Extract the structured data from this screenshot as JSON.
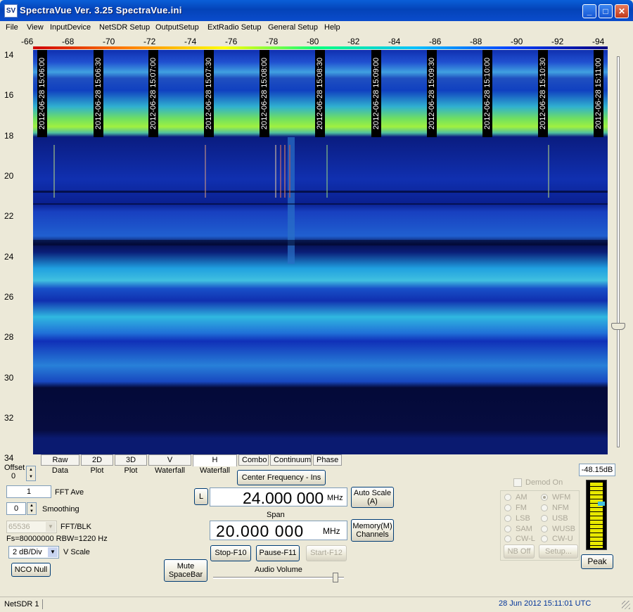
{
  "window": {
    "title": "SpectraVue Ver. 3.25  SpectraVue.ini",
    "icon_text": "SV",
    "minimize_label": "_",
    "maximize_label": "□",
    "close_label": "✕"
  },
  "menu": [
    "File",
    "View",
    "InputDevice",
    "NetSDR Setup",
    "OutputSetup",
    "ExtRadio Setup",
    "General Setup",
    "Help"
  ],
  "scale_labels": [
    "-66",
    "-68",
    "-70",
    "-72",
    "-74",
    "-76",
    "-78",
    "-80",
    "-82",
    "-84",
    "-86",
    "-88",
    "-90",
    "-92",
    "-94"
  ],
  "y_labels": [
    "14",
    "16",
    "18",
    "20",
    "22",
    "24",
    "26",
    "28",
    "30",
    "32",
    "34"
  ],
  "timestamps": [
    "2012-06-28 15:06:00",
    "2012-06-28 15:06:30",
    "2012-06-28 15:07:00",
    "2012-06-28 15:07:30",
    "2012-06-28 15:08:00",
    "2012-06-28 15:08:30",
    "2012-06-28 15:09:00",
    "2012-06-28 15:09:30",
    "2012-06-28 15:10:00",
    "2012-06-28 15:10:30",
    "2012-06-28 15:11:00"
  ],
  "tabs": [
    "Raw Data",
    "2D Plot",
    "3D Plot",
    "V Waterfall",
    "H Waterfall",
    "Combo",
    "Continuum",
    "Phase"
  ],
  "active_tab": "H Waterfall",
  "left_panel": {
    "offset_label": "Offset",
    "offset_value": "0",
    "fft_ave_value": "1",
    "fft_ave_label": "FFT Ave",
    "smoothing_value": "0",
    "smoothing_label": "Smoothing",
    "fft_blk_value": "65536",
    "fft_blk_label": "FFT/BLK",
    "fs_text": "Fs=80000000 RBW=1220 Hz",
    "vscale_value": "2 dB/Div",
    "vscale_label": "V Scale",
    "nco_null": "NCO Null"
  },
  "center": {
    "center_freq_button": "Center Frequency - Ins",
    "l_button": "L",
    "center_freq_value": "24.000 000",
    "center_freq_unit": "MHz",
    "auto_scale": "Auto Scale",
    "auto_scale_key": "(A)",
    "span_label": "Span",
    "span_value": "20.000 000",
    "span_unit": "MHz",
    "memory": "Memory(M)",
    "channels": "Channels",
    "stop": "Stop-F10",
    "pause": "Pause-F11",
    "start": "Start-F12",
    "mute": "Mute",
    "spacebar": "SpaceBar",
    "audio_volume": "Audio Volume"
  },
  "demod": {
    "demod_on": "Demod On",
    "modes_left": [
      "AM",
      "FM",
      "LSB",
      "SAM",
      "CW-L"
    ],
    "modes_right": [
      "WFM",
      "NFM",
      "USB",
      "WUSB",
      "CW-U"
    ],
    "selected": "WFM",
    "nb_off": "NB Off",
    "setup": "Setup..."
  },
  "meter": {
    "level": "-48.15dB",
    "peak": "Peak"
  },
  "status": {
    "left": "NetSDR 1",
    "datetime": "28 Jun 2012  15:11:01 UTC"
  }
}
